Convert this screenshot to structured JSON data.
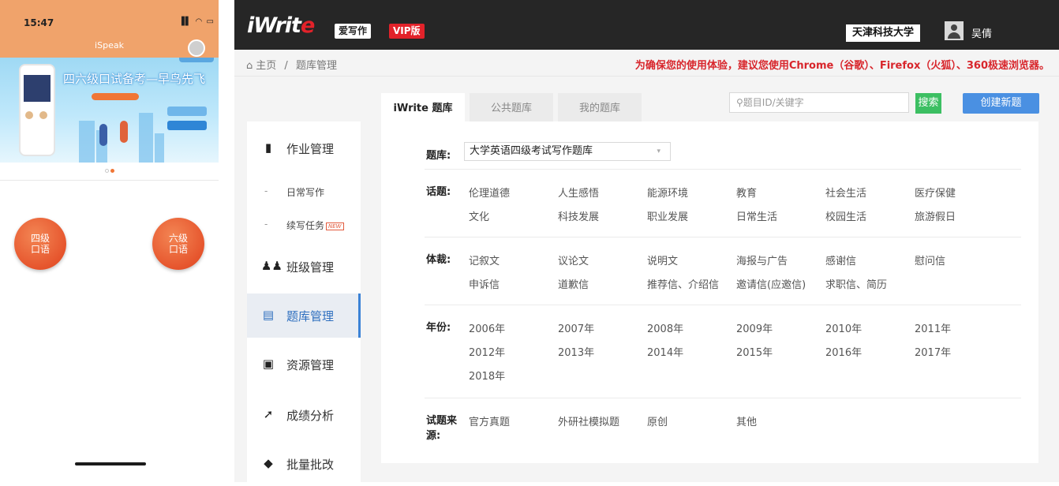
{
  "phone": {
    "time": "15:47",
    "status_icons": "▐▌ ◠ ▭",
    "app_title": "iSpeak",
    "banner_headline": "四六级口试备考—早鸟先飞",
    "btn_cet4": [
      "四级",
      "口语"
    ],
    "btn_cet6": [
      "六级",
      "口语"
    ]
  },
  "header": {
    "logo_main": "iWrit",
    "logo_accent": "e",
    "brand_badge": "爱写作",
    "vip_badge": "VIP版",
    "school": "天津科技大学",
    "user_name": "吴倩"
  },
  "breadcrumb": {
    "home": "主页",
    "sep": "/",
    "current": "题库管理"
  },
  "notice": "为确保您的使用体验，建议您使用Chrome（谷歌）、Firefox（火狐）、360极速浏览器。",
  "sidebar": {
    "items": [
      {
        "label": "作业管理",
        "icon": "document-icon"
      },
      {
        "label": "日常写作",
        "sub": true
      },
      {
        "label": "续写任务",
        "sub": true,
        "badge": "NEW"
      },
      {
        "label": "班级管理",
        "icon": "users-icon"
      },
      {
        "label": "题库管理",
        "icon": "clipboard-icon",
        "active": true
      },
      {
        "label": "资源管理",
        "icon": "download-box-icon"
      },
      {
        "label": "成绩分析",
        "icon": "trend-icon"
      },
      {
        "label": "批量批改",
        "icon": "layers-icon"
      }
    ]
  },
  "tabs": [
    {
      "label": "iWrite 题库",
      "active": true
    },
    {
      "label": "公共题库"
    },
    {
      "label": "我的题库"
    }
  ],
  "search": {
    "placeholder": "题目ID/关键字",
    "button": "搜索",
    "create_button": "创建新题"
  },
  "filters": {
    "bank_label": "题库:",
    "bank_value": "大学英语四级考试写作题库",
    "topic_label": "话题:",
    "topics": [
      "伦理道德",
      "人生感悟",
      "能源环境",
      "教育",
      "社会生活",
      "医疗保健",
      "文化",
      "科技发展",
      "职业发展",
      "日常生活",
      "校园生活",
      "旅游假日"
    ],
    "genre_label": "体裁:",
    "genres": [
      "记叙文",
      "议论文",
      "说明文",
      "海报与广告",
      "感谢信",
      "慰问信",
      "申诉信",
      "道歉信",
      "推荐信、介绍信",
      "邀请信(应邀信)",
      "求职信、简历"
    ],
    "year_label": "年份:",
    "years": [
      "2006年",
      "2007年",
      "2008年",
      "2009年",
      "2010年",
      "2011年",
      "2012年",
      "2013年",
      "2014年",
      "2015年",
      "2016年",
      "2017年",
      "2018年"
    ],
    "source_label": "试题来源:",
    "sources": [
      "官方真题",
      "外研社模拟题",
      "原创",
      "其他"
    ]
  },
  "colors": {
    "accent_blue": "#4a90e2",
    "notice_red": "#d8262c",
    "search_green": "#3cbf62",
    "phone_orange": "#f0a36b"
  }
}
